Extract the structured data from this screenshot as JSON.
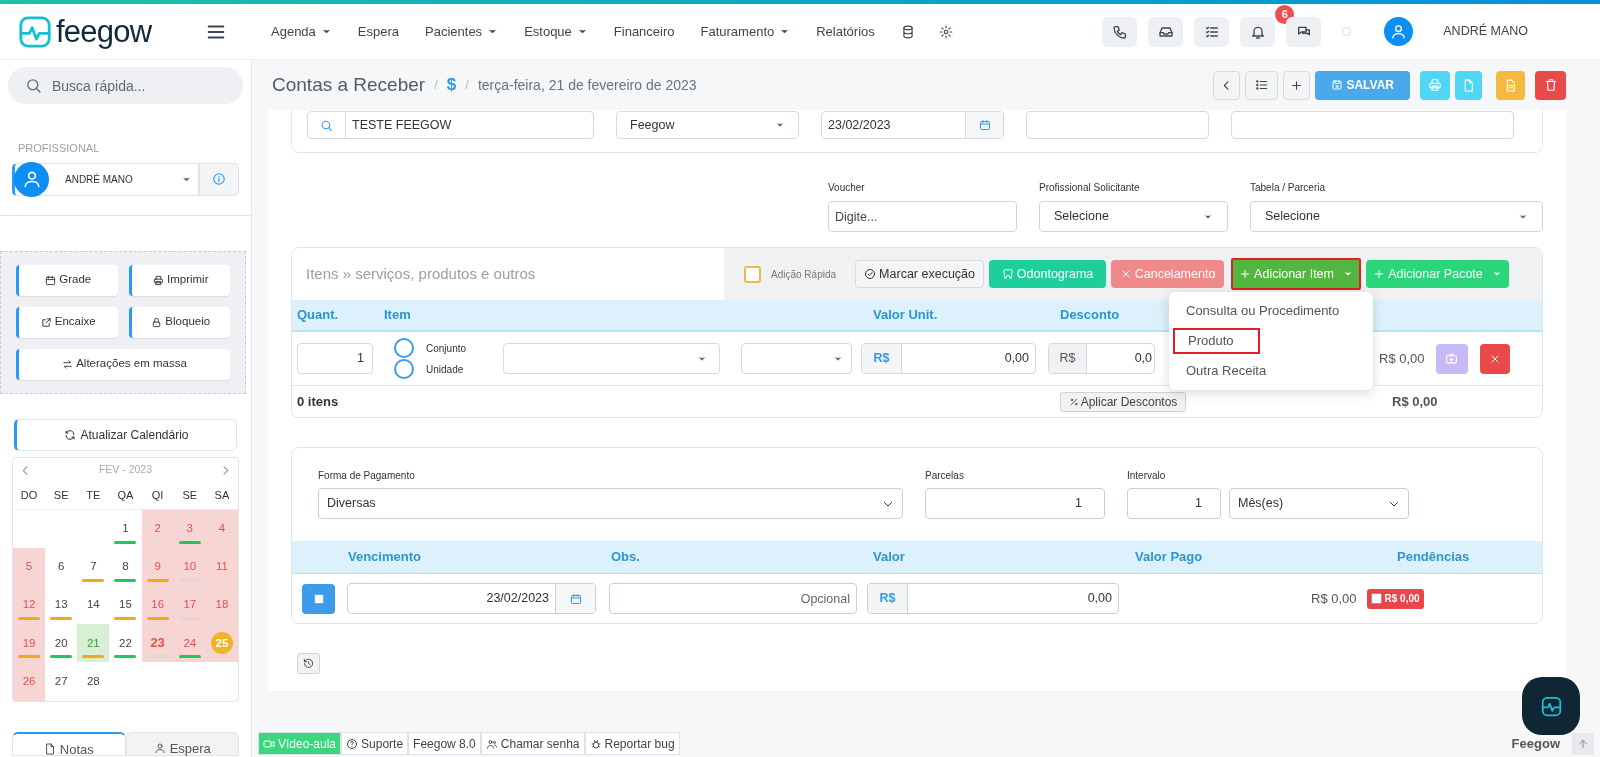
{
  "logo": "feegow",
  "nav": [
    {
      "label": "Agenda",
      "dropdown": true
    },
    {
      "label": "Espera",
      "dropdown": false
    },
    {
      "label": "Pacientes",
      "dropdown": true
    },
    {
      "label": "Estoque",
      "dropdown": true
    },
    {
      "label": "Financeiro",
      "dropdown": false
    },
    {
      "label": "Faturamento",
      "dropdown": true
    },
    {
      "label": "Relatórios",
      "dropdown": false
    }
  ],
  "notification_count": "6",
  "user_name": "ANDRÉ MANO",
  "sidebar": {
    "search": {
      "placeholder": "Busca rápida..."
    },
    "professional_label": "PROFISSIONAL",
    "professional": "ANDRÉ MANO",
    "buttons": [
      "Grade",
      "Imprimir",
      "Encaixe",
      "Bloqueio",
      "Alterações em massa"
    ],
    "refresh_button": "Atualizar Calendário",
    "calendar": {
      "month": "FEV - 2023",
      "weekdays": [
        "DO",
        "SE",
        "TE",
        "QA",
        "QI",
        "SE",
        "SA"
      ],
      "weeks": [
        [
          {
            "kind": "empty"
          },
          {
            "kind": "empty"
          },
          {
            "kind": "empty"
          },
          {
            "kind": "day",
            "day": "1",
            "blocked": false,
            "selected": false,
            "current": false,
            "emphasized": false,
            "color": "#22c55e"
          },
          {
            "kind": "day",
            "day": "2",
            "blocked": true,
            "selected": false,
            "current": false,
            "emphasized": false
          },
          {
            "kind": "day",
            "day": "3",
            "blocked": true,
            "selected": false,
            "current": false,
            "emphasized": false,
            "color": "#22c55e"
          },
          {
            "kind": "day",
            "day": "4",
            "blocked": true,
            "selected": false,
            "current": false,
            "emphasized": false
          }
        ],
        [
          {
            "kind": "day",
            "day": "5",
            "blocked": true,
            "selected": false,
            "current": false,
            "emphasized": false
          },
          {
            "kind": "day",
            "day": "6",
            "blocked": false,
            "selected": false,
            "current": false,
            "emphasized": false
          },
          {
            "kind": "day",
            "day": "7",
            "blocked": false,
            "selected": false,
            "current": false,
            "emphasized": false,
            "color": "#f0a81c"
          },
          {
            "kind": "day",
            "day": "8",
            "blocked": false,
            "selected": false,
            "current": false,
            "emphasized": false,
            "color": "#22c55e"
          },
          {
            "kind": "day",
            "day": "9",
            "blocked": true,
            "selected": false,
            "current": false,
            "emphasized": false,
            "color": "#f0a81c"
          },
          {
            "kind": "day",
            "day": "10",
            "blocked": true,
            "selected": false,
            "current": false,
            "emphasized": false,
            "color": "#d9d9d9"
          },
          {
            "kind": "day",
            "day": "11",
            "blocked": true,
            "selected": false,
            "current": false,
            "emphasized": false
          }
        ],
        [
          {
            "kind": "day",
            "day": "12",
            "blocked": true,
            "selected": false,
            "current": false,
            "emphasized": false,
            "color": "#f0a81c"
          },
          {
            "kind": "day",
            "day": "13",
            "blocked": false,
            "selected": false,
            "current": false,
            "emphasized": false,
            "color": "#f0a81c"
          },
          {
            "kind": "day",
            "day": "14",
            "blocked": false,
            "selected": false,
            "current": false,
            "emphasized": false
          },
          {
            "kind": "day",
            "day": "15",
            "blocked": false,
            "selected": false,
            "current": false,
            "emphasized": false,
            "color": "#f0a81c"
          },
          {
            "kind": "day",
            "day": "16",
            "blocked": true,
            "selected": false,
            "current": false,
            "emphasized": false,
            "color": "#f0a81c"
          },
          {
            "kind": "day",
            "day": "17",
            "blocked": true,
            "selected": false,
            "current": false,
            "emphasized": false,
            "color": "#d9d9d9"
          },
          {
            "kind": "day",
            "day": "18",
            "blocked": true,
            "selected": false,
            "current": false,
            "emphasized": false
          }
        ],
        [
          {
            "kind": "day",
            "day": "19",
            "blocked": true,
            "selected": false,
            "current": false,
            "emphasized": false,
            "color": "#f0a81c"
          },
          {
            "kind": "day",
            "day": "20",
            "blocked": false,
            "selected": false,
            "current": false,
            "emphasized": false,
            "color": "#22c55e"
          },
          {
            "kind": "day",
            "day": "21",
            "blocked": false,
            "selected": true,
            "current": false,
            "emphasized": false,
            "color": "#f0a81c"
          },
          {
            "kind": "day",
            "day": "22",
            "blocked": false,
            "selected": false,
            "current": false,
            "emphasized": false,
            "color": "#22c55e"
          },
          {
            "kind": "day",
            "day": "23",
            "blocked": true,
            "selected": false,
            "current": false,
            "emphasized": true,
            "color": "#d9d9d9"
          },
          {
            "kind": "day",
            "day": "24",
            "blocked": true,
            "selected": false,
            "current": false,
            "emphasized": false,
            "color": "#22c55e"
          },
          {
            "kind": "day",
            "day": "25",
            "blocked": true,
            "selected": false,
            "current": true,
            "emphasized": false
          }
        ],
        [
          {
            "kind": "day",
            "day": "26",
            "blocked": true,
            "selected": false,
            "current": false,
            "emphasized": false
          },
          {
            "kind": "day",
            "day": "27",
            "blocked": false,
            "selected": false,
            "current": false,
            "emphasized": false
          },
          {
            "kind": "day",
            "day": "28",
            "blocked": false,
            "selected": false,
            "current": false,
            "emphasized": false
          },
          {
            "kind": "empty"
          },
          {
            "kind": "empty"
          },
          {
            "kind": "empty"
          },
          {
            "kind": "empty"
          }
        ]
      ]
    },
    "tabs": [
      {
        "label": "Notas",
        "selected": true
      },
      {
        "label": "Espera",
        "selected": false
      }
    ]
  },
  "breadcrumb": {
    "title": "Contas a Receber",
    "separator": "/",
    "section_icon": "$",
    "date": "terça-feira, 21 de fevereiro de 2023"
  },
  "save_button": "SALVAR",
  "top_fields": {
    "patient": "TESTE FEEGOW",
    "company": "Feegow",
    "date": "23/02/2023"
  },
  "extra_fields": [
    {
      "label": "Voucher",
      "placeholder": "Digite...",
      "kind": "input"
    },
    {
      "label": "Profissional Solicitante",
      "value": "Selecione",
      "kind": "select"
    },
    {
      "label": "Tabela / Parceria",
      "value": "Selecione",
      "kind": "select"
    }
  ],
  "items": {
    "title": "Itens » serviços, produtos e outros",
    "quick_add": {
      "label": "Adição Rápida",
      "checked": false
    },
    "buttons": [
      "Marcar execução",
      "Odontograma",
      "Cancelamento"
    ],
    "add_item": "Adicionar Item",
    "add_package": "Adicionar Pacote",
    "columns": [
      "Quant.",
      "Item",
      "Valor Unit.",
      "Desconto"
    ],
    "row": {
      "quantity": "1",
      "options": [
        {
          "label": "Conjunto",
          "selected": false
        },
        {
          "label": "Unidade",
          "selected": false
        }
      ],
      "currency": "R$",
      "unit_value": "0,00",
      "discount_currency": "R$",
      "discount": "0,0",
      "total": "R$ 0,00"
    },
    "count": "0 itens",
    "apply_discounts": "Aplicar Descontos",
    "sum": "R$ 0,00",
    "menu": [
      {
        "label": "Consulta ou Procedimento",
        "selected": false
      },
      {
        "label": "Produto",
        "selected": true
      },
      {
        "label": "Outra Receita",
        "selected": false
      }
    ]
  },
  "payment": {
    "method_label": "Forma de Pagamento",
    "method": "Diversas",
    "installments_label": "Parcelas",
    "installments": "1",
    "interval_label": "Intervalo",
    "interval": "1",
    "interval_unit": "Mês(es)",
    "columns": [
      "Vencimento",
      "Obs.",
      "Valor",
      "Valor Pago",
      "Pendências"
    ],
    "row": {
      "due": "23/02/2023",
      "notes_placeholder": "Opcional",
      "currency": "R$",
      "value": "0,00",
      "paid": "R$ 0,00",
      "pending": "R$ 0,00",
      "pending_checked": false
    }
  },
  "footer": {
    "links": [
      "Vídeo-aula",
      "Suporte",
      "Feegow 8.0",
      "Chamar senha",
      "Reportar bug"
    ],
    "brand": "Feegow"
  }
}
